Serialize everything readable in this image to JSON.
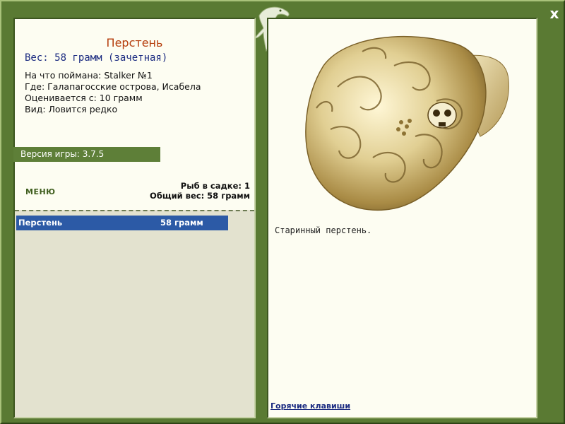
{
  "window": {
    "close_label": "x"
  },
  "fish": {
    "title": "Перстень",
    "weight_line": "Вес: 58 грамм (зачетная)",
    "caught_on": "На что поймана: Stalker №1",
    "location": "Где: Галапагосские острова, Исабела",
    "valued_from": "Оценивается с: 10 грамм",
    "rarity": "Вид: Ловится редко",
    "description": "Старинный перстень."
  },
  "game": {
    "version": "Версия игры: 3.7.5"
  },
  "menu": {
    "label": "МЕНЮ"
  },
  "cage": {
    "count_line": "Рыб в садке: 1",
    "total_weight_line": "Общий вес: 58 грамм",
    "items": [
      {
        "name": "Перстень",
        "weight": "58 грамм"
      }
    ]
  },
  "links": {
    "hotkeys": "Горячие клавиши"
  },
  "colors": {
    "frame_green": "#5a7a33",
    "panel_cream": "#fdfdf2",
    "title_orange": "#b53d0c",
    "weight_blue": "#1a2a80",
    "selection_blue": "#2c5aa6"
  },
  "icons": {
    "logo": "dolphin-icon",
    "close": "close-icon"
  }
}
